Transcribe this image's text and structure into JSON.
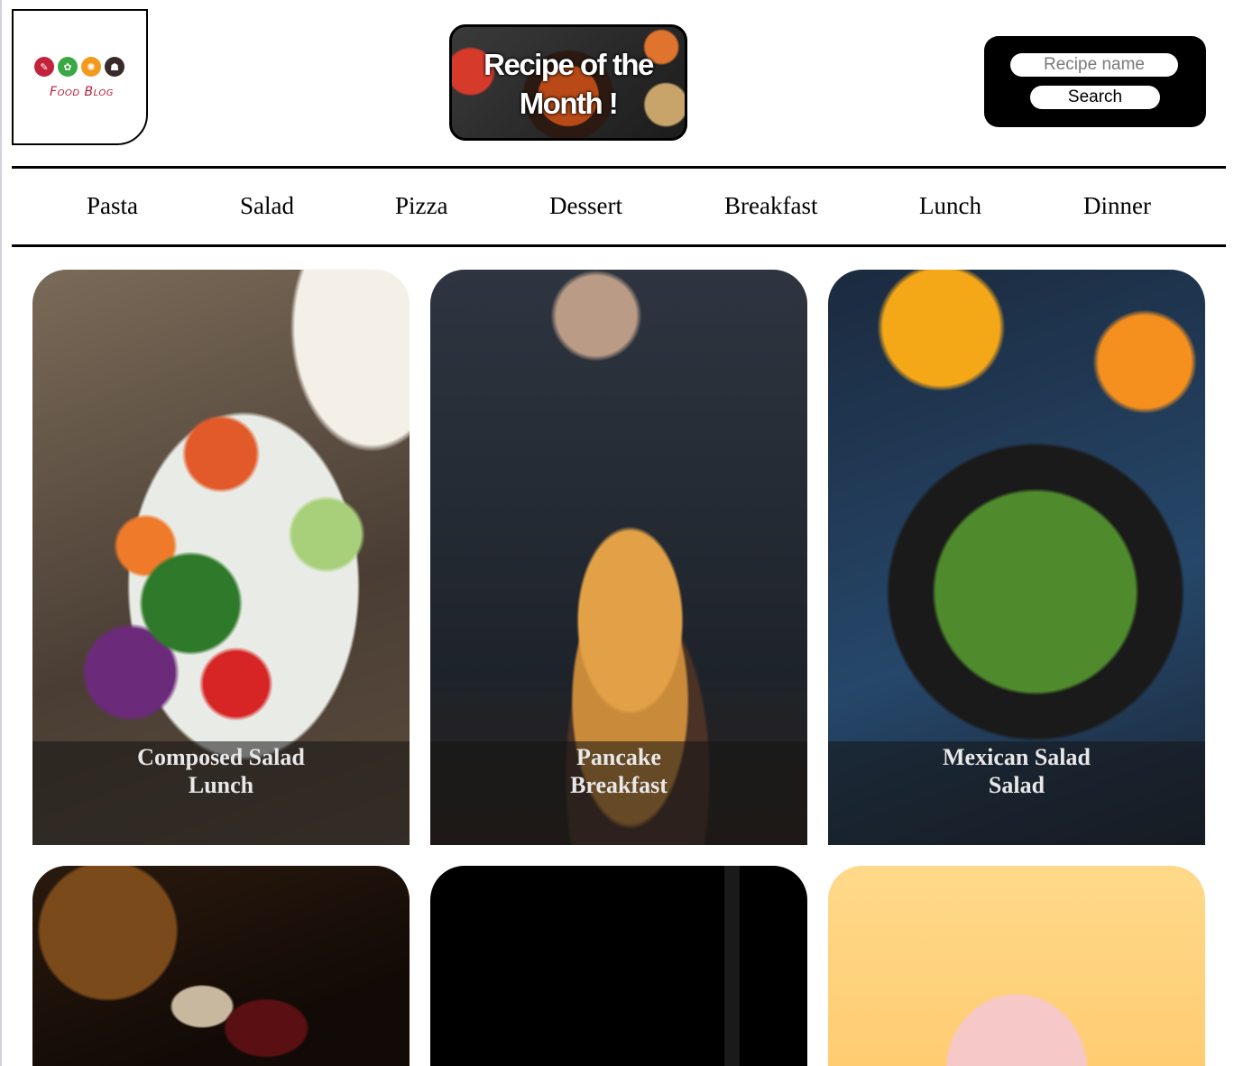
{
  "header": {
    "logo_text": "Food Blog",
    "banner_text": "Recipe of the Month !",
    "search": {
      "placeholder": "Recipe name",
      "button_label": "Search"
    }
  },
  "nav": {
    "items": [
      "Pasta",
      "Salad",
      "Pizza",
      "Dessert",
      "Breakfast",
      "Lunch",
      "Dinner"
    ]
  },
  "cards": [
    {
      "title": "Composed Salad",
      "category": "Lunch"
    },
    {
      "title": "Pancake",
      "category": "Breakfast"
    },
    {
      "title": "Mexican Salad",
      "category": "Salad"
    },
    {
      "title": "",
      "category": ""
    },
    {
      "title": "",
      "category": ""
    },
    {
      "title": "",
      "category": ""
    }
  ],
  "colors": {
    "accent": "#000000",
    "logo_red": "#b31f3a",
    "caption_overlay": "rgba(20,20,20,0.55)"
  }
}
